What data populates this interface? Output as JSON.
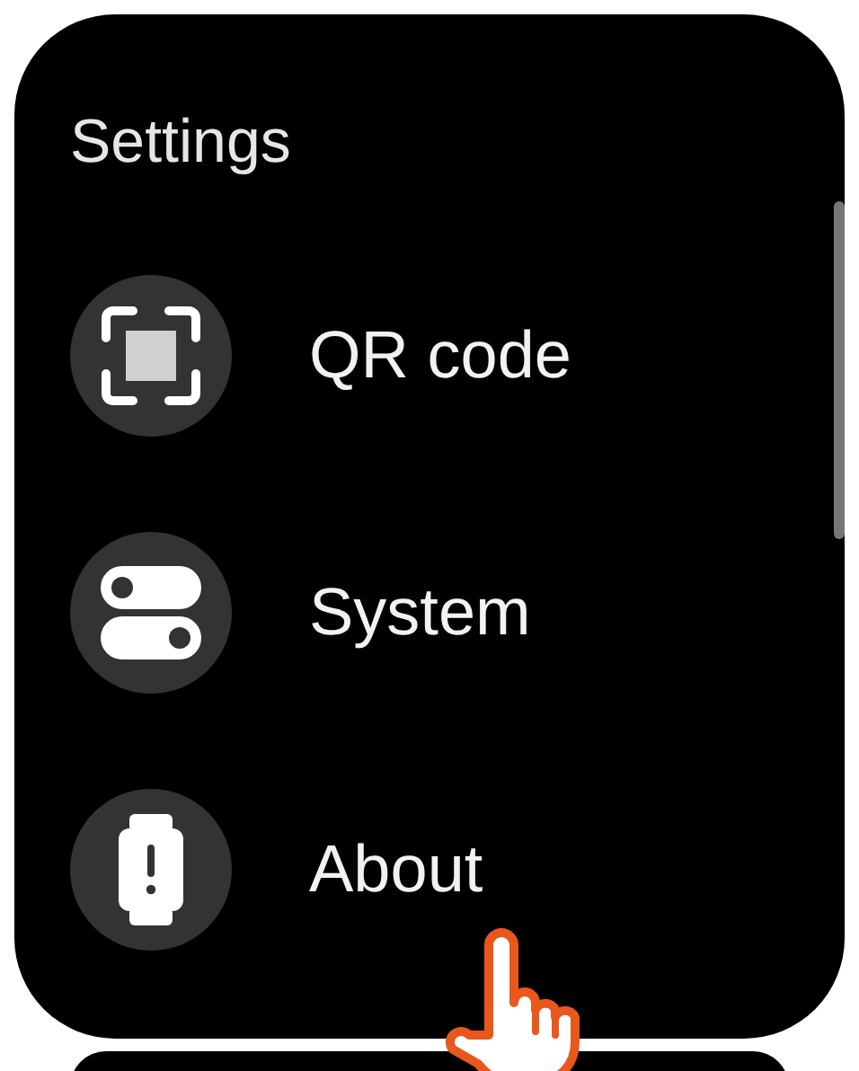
{
  "screen": {
    "title": "Settings"
  },
  "items": [
    {
      "kind": "qr",
      "label": "QR code"
    },
    {
      "kind": "toggles",
      "label": "System"
    },
    {
      "kind": "watch",
      "label": "About"
    }
  ]
}
